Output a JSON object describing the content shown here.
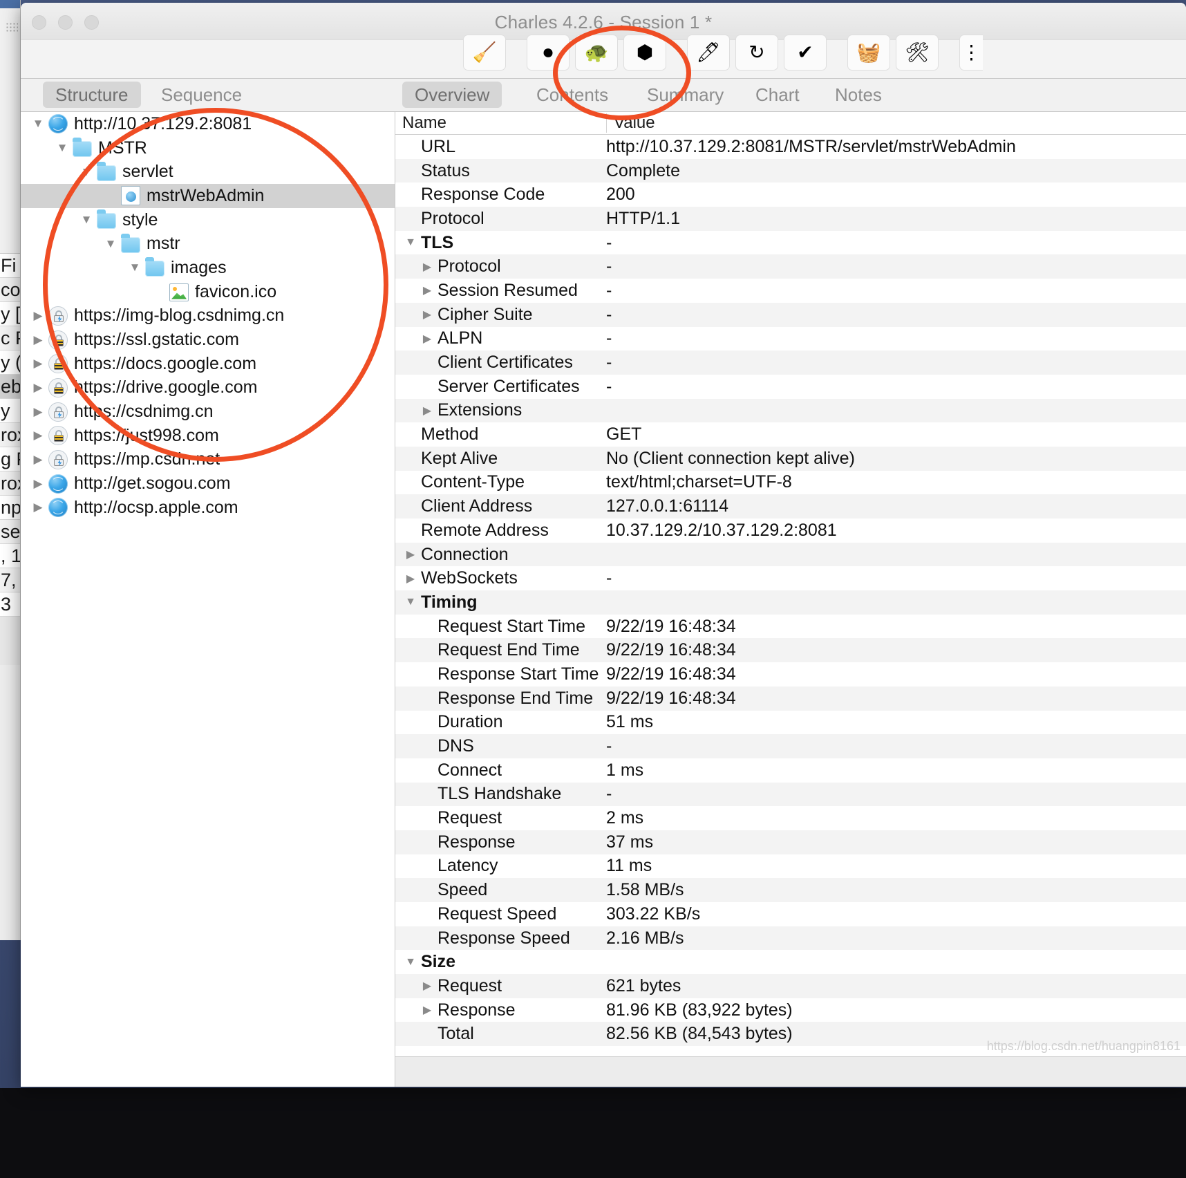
{
  "window": {
    "title": "Charles 4.2.6 - Session 1 *",
    "traffic_lights": [
      "close",
      "minimize",
      "zoom"
    ]
  },
  "toolbar": {
    "buttons": [
      {
        "name": "clear-session-button",
        "icon": "broom-icon",
        "glyph": "🧹"
      },
      {
        "name": "record-button",
        "icon": "record-icon",
        "glyph": "⏺"
      },
      {
        "name": "throttle-button",
        "icon": "turtle-icon",
        "glyph": "🐢"
      },
      {
        "name": "breakpoints-button",
        "icon": "hexagon-icon",
        "glyph": "⬢"
      },
      {
        "name": "compose-button",
        "icon": "pen-icon",
        "glyph": "🖊"
      },
      {
        "name": "repeat-button",
        "icon": "refresh-icon",
        "glyph": "↻"
      },
      {
        "name": "validate-button",
        "icon": "checkmark-icon",
        "glyph": "✔"
      },
      {
        "name": "tools-basket-button",
        "icon": "basket-icon",
        "glyph": "🧺"
      },
      {
        "name": "settings-button",
        "icon": "tools-icon",
        "glyph": "🛠"
      }
    ]
  },
  "left_tabs": [
    {
      "label": "Structure",
      "active": true
    },
    {
      "label": "Sequence",
      "active": false
    }
  ],
  "right_tabs": [
    {
      "label": "Overview",
      "active": true
    },
    {
      "label": "Contents",
      "active": false
    },
    {
      "label": "Summary",
      "active": false
    },
    {
      "label": "Chart",
      "active": false
    },
    {
      "label": "Notes",
      "active": false
    }
  ],
  "tree": [
    {
      "label": "http://10.37.129.2:8081",
      "icon": "globe-icon",
      "depth": 0,
      "twisty": "open",
      "selected": false
    },
    {
      "label": "MSTR",
      "icon": "folder-icon",
      "depth": 1,
      "twisty": "open",
      "selected": false
    },
    {
      "label": "servlet",
      "icon": "folder-icon",
      "depth": 2,
      "twisty": "open",
      "selected": false
    },
    {
      "label": "mstrWebAdmin",
      "icon": "document-icon",
      "depth": 3,
      "twisty": "none",
      "selected": true
    },
    {
      "label": "style",
      "icon": "folder-icon",
      "depth": 2,
      "twisty": "open",
      "selected": false
    },
    {
      "label": "mstr",
      "icon": "folder-icon",
      "depth": 3,
      "twisty": "open",
      "selected": false
    },
    {
      "label": "images",
      "icon": "folder-icon",
      "depth": 4,
      "twisty": "open",
      "selected": false
    },
    {
      "label": "favicon.ico",
      "icon": "image-icon",
      "depth": 5,
      "twisty": "none",
      "selected": false
    },
    {
      "label": "https://img-blog.csdnimg.cn",
      "icon": "lock-bolt-icon",
      "depth": 0,
      "twisty": "closed",
      "selected": false
    },
    {
      "label": "https://ssl.gstatic.com",
      "icon": "lock-icon",
      "depth": 0,
      "twisty": "closed",
      "selected": false
    },
    {
      "label": "https://docs.google.com",
      "icon": "lock-icon",
      "depth": 0,
      "twisty": "closed",
      "selected": false
    },
    {
      "label": "https://drive.google.com",
      "icon": "lock-icon",
      "depth": 0,
      "twisty": "closed",
      "selected": false
    },
    {
      "label": "https://csdnimg.cn",
      "icon": "lock-bolt-icon",
      "depth": 0,
      "twisty": "closed",
      "selected": false
    },
    {
      "label": "https://just998.com",
      "icon": "lock-icon",
      "depth": 0,
      "twisty": "closed",
      "selected": false
    },
    {
      "label": "https://mp.csdn.net",
      "icon": "lock-bolt-icon",
      "depth": 0,
      "twisty": "closed",
      "selected": false
    },
    {
      "label": "http://get.sogou.com",
      "icon": "globe-icon",
      "depth": 0,
      "twisty": "closed",
      "selected": false
    },
    {
      "label": "http://ocsp.apple.com",
      "icon": "globe-icon",
      "depth": 0,
      "twisty": "closed",
      "selected": false
    }
  ],
  "details_table": {
    "columns": {
      "name": "Name",
      "value": "Value"
    },
    "rows": [
      {
        "name": "URL",
        "value": "http://10.37.129.2:8081/MSTR/servlet/mstrWebAdmin",
        "indent": 0,
        "twisty": "none",
        "group": false
      },
      {
        "name": "Status",
        "value": "Complete",
        "indent": 0,
        "twisty": "none",
        "group": false
      },
      {
        "name": "Response Code",
        "value": "200",
        "indent": 0,
        "twisty": "none",
        "group": false
      },
      {
        "name": "Protocol",
        "value": "HTTP/1.1",
        "indent": 0,
        "twisty": "none",
        "group": false
      },
      {
        "name": "TLS",
        "value": "-",
        "indent": 0,
        "twisty": "open",
        "group": true
      },
      {
        "name": "Protocol",
        "value": "-",
        "indent": 1,
        "twisty": "closed",
        "group": false
      },
      {
        "name": "Session Resumed",
        "value": "-",
        "indent": 1,
        "twisty": "closed",
        "group": false
      },
      {
        "name": "Cipher Suite",
        "value": "-",
        "indent": 1,
        "twisty": "closed",
        "group": false
      },
      {
        "name": "ALPN",
        "value": "-",
        "indent": 1,
        "twisty": "closed",
        "group": false
      },
      {
        "name": "Client Certificates",
        "value": "-",
        "indent": 1,
        "twisty": "none",
        "group": false
      },
      {
        "name": "Server Certificates",
        "value": "-",
        "indent": 1,
        "twisty": "none",
        "group": false
      },
      {
        "name": "Extensions",
        "value": "",
        "indent": 1,
        "twisty": "closed",
        "group": false
      },
      {
        "name": "Method",
        "value": "GET",
        "indent": 0,
        "twisty": "none",
        "group": false
      },
      {
        "name": "Kept Alive",
        "value": "No (Client connection kept alive)",
        "indent": 0,
        "twisty": "none",
        "group": false
      },
      {
        "name": "Content-Type",
        "value": "text/html;charset=UTF-8",
        "indent": 0,
        "twisty": "none",
        "group": false
      },
      {
        "name": "Client Address",
        "value": "127.0.0.1:61114",
        "indent": 0,
        "twisty": "none",
        "group": false
      },
      {
        "name": "Remote Address",
        "value": "10.37.129.2/10.37.129.2:8081",
        "indent": 0,
        "twisty": "none",
        "group": false
      },
      {
        "name": "Connection",
        "value": "",
        "indent": 0,
        "twisty": "closed",
        "group": false
      },
      {
        "name": "WebSockets",
        "value": "-",
        "indent": 0,
        "twisty": "closed",
        "group": false
      },
      {
        "name": "Timing",
        "value": "",
        "indent": 0,
        "twisty": "open",
        "group": true
      },
      {
        "name": "Request Start Time",
        "value": "9/22/19 16:48:34",
        "indent": 1,
        "twisty": "none",
        "group": false
      },
      {
        "name": "Request End Time",
        "value": "9/22/19 16:48:34",
        "indent": 1,
        "twisty": "none",
        "group": false
      },
      {
        "name": "Response Start Time",
        "value": "9/22/19 16:48:34",
        "indent": 1,
        "twisty": "none",
        "group": false
      },
      {
        "name": "Response End Time",
        "value": "9/22/19 16:48:34",
        "indent": 1,
        "twisty": "none",
        "group": false
      },
      {
        "name": "Duration",
        "value": "51 ms",
        "indent": 1,
        "twisty": "none",
        "group": false
      },
      {
        "name": "DNS",
        "value": "-",
        "indent": 1,
        "twisty": "none",
        "group": false
      },
      {
        "name": "Connect",
        "value": "1 ms",
        "indent": 1,
        "twisty": "none",
        "group": false
      },
      {
        "name": "TLS Handshake",
        "value": "-",
        "indent": 1,
        "twisty": "none",
        "group": false
      },
      {
        "name": "Request",
        "value": "2 ms",
        "indent": 1,
        "twisty": "none",
        "group": false
      },
      {
        "name": "Response",
        "value": "37 ms",
        "indent": 1,
        "twisty": "none",
        "group": false
      },
      {
        "name": "Latency",
        "value": "11 ms",
        "indent": 1,
        "twisty": "none",
        "group": false
      },
      {
        "name": "Speed",
        "value": "1.58 MB/s",
        "indent": 1,
        "twisty": "none",
        "group": false
      },
      {
        "name": "Request Speed",
        "value": "303.22 KB/s",
        "indent": 1,
        "twisty": "none",
        "group": false
      },
      {
        "name": "Response Speed",
        "value": "2.16 MB/s",
        "indent": 1,
        "twisty": "none",
        "group": false
      },
      {
        "name": "Size",
        "value": "",
        "indent": 0,
        "twisty": "open",
        "group": true
      },
      {
        "name": "Request",
        "value": "621 bytes",
        "indent": 1,
        "twisty": "closed",
        "group": false
      },
      {
        "name": "Response",
        "value": "81.96 KB (83,922 bytes)",
        "indent": 1,
        "twisty": "closed",
        "group": false
      },
      {
        "name": "Total",
        "value": "82.56 KB (84,543 bytes)",
        "indent": 1,
        "twisty": "none",
        "group": false
      }
    ]
  },
  "watermark": "https://blog.csdn.net/huangpin8161",
  "background_window_fragments": [
    "Fi",
    "co",
    "y [",
    "c P",
    "y (",
    "eb",
    "y",
    "rox",
    "g P",
    "rox",
    "np",
    "se",
    ", 1",
    "7,",
    "3"
  ],
  "annotations": {
    "color": "#ef4d24",
    "shapes": [
      {
        "name": "tree-highlight-ellipse"
      },
      {
        "name": "tabs-highlight-ellipse"
      }
    ]
  }
}
